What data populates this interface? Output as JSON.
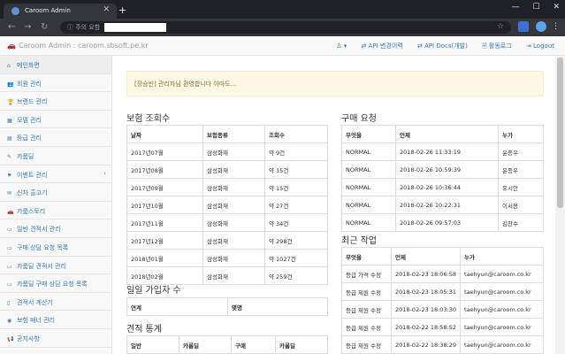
{
  "browser": {
    "tab_title": "Caroom Admin",
    "tab_close": "✕",
    "new_tab": "+",
    "window_controls": [
      "—",
      "☐",
      "✕"
    ],
    "security_label": "ⓘ 주의 요함",
    "back": "←",
    "forward": "→",
    "reload": "↻",
    "bookmark_star": "☆",
    "menu": "⋮"
  },
  "navbar": {
    "brand": "Caroom Admin : caroom.sbsoft.pe.kr",
    "brand_icon": "🚗",
    "user_menu": "♙ ▾",
    "api_changes": "⇄ API 변경이력",
    "api_docs": "⇄ API Docs(개발)",
    "activity_log": "🗎 활동로그",
    "logout": "⇥ Logout"
  },
  "sidebar": {
    "items": [
      {
        "icon": "⌂",
        "label": "메인화면"
      },
      {
        "icon": "👥",
        "label": "회원 관리"
      },
      {
        "icon": "🏆",
        "label": "브랜드 관리"
      },
      {
        "icon": "▦",
        "label": "모델 관리"
      },
      {
        "icon": "▤",
        "label": "등급 관리"
      },
      {
        "icon": "✎",
        "label": "카룸딜"
      },
      {
        "icon": "⚑",
        "label": "이벤트 관리"
      },
      {
        "icon": "✉",
        "label": "신차 출고기"
      },
      {
        "icon": "🚗",
        "label": "카룸스토리"
      },
      {
        "icon": "▭",
        "label": "일반 견적서 관리"
      },
      {
        "icon": "▭",
        "label": "구매 상담 요청 목록"
      },
      {
        "icon": "▭",
        "label": "카룸딜 견적서 관리"
      },
      {
        "icon": "▭",
        "label": "카룸딜 구매 상담 요청 목록"
      },
      {
        "icon": "▯",
        "label": "견적서 계산기"
      },
      {
        "icon": "◉",
        "label": "보험 배너 관리"
      },
      {
        "icon": "📢",
        "label": "공지사항"
      }
    ],
    "event_chevron": "‹"
  },
  "main": {
    "alert": "[장승빈] 관리자님 환영합니다 아마도...",
    "insurance": {
      "title": "보험 조회수",
      "headers": [
        "날짜",
        "보험종류",
        "조회수"
      ],
      "rows": [
        [
          "2017년07월",
          "삼성화재",
          "약 9건"
        ],
        [
          "2017년08월",
          "삼성화재",
          "약 15건"
        ],
        [
          "2017년09월",
          "삼성화재",
          "약 15건"
        ],
        [
          "2017년10월",
          "삼성화재",
          "약 27건"
        ],
        [
          "2017년11월",
          "삼성화재",
          "약 34건"
        ],
        [
          "2017년12월",
          "삼성화재",
          "약 298건"
        ],
        [
          "2018년01월",
          "삼성화재",
          "약 1027건"
        ],
        [
          "2018년02월",
          "삼성화재",
          "약 259건"
        ]
      ]
    },
    "signup": {
      "title": "일일 가입자 수",
      "headers": [
        "연계",
        "몇명"
      ]
    },
    "estimate": {
      "title": "견적 통계",
      "headers": [
        "일반",
        "카룸딜",
        "구매",
        "카룸딜"
      ]
    },
    "purchase": {
      "title": "구매 요청",
      "headers": [
        "무엇을",
        "언제",
        "누가"
      ],
      "rows": [
        [
          "NORMAL",
          "2018-02-26 11:33:19",
          "윤종우"
        ],
        [
          "NORMAL",
          "2018-02-26 10:59:39",
          "윤종우"
        ],
        [
          "NORMAL",
          "2018-02-26 10:36:44",
          "유시안"
        ],
        [
          "NORMAL",
          "2018-02-26 10:22:31",
          "이서용"
        ],
        [
          "NORMAL",
          "2018-02-26 09:57:03",
          "김찬수"
        ]
      ]
    },
    "recent": {
      "title": "최근 작업",
      "headers": [
        "무엇을",
        "언제",
        "누가"
      ],
      "rows": [
        [
          "등급 가격 수정",
          "2018-02-23 18:06:58",
          "taehyun@caroom.co.kr"
        ],
        [
          "등급 제원 수정",
          "2018-02-23 18:05:31",
          "taehyun@caroom.co.kr"
        ],
        [
          "등급 제원 수정",
          "2018-02-23 18:03:30",
          "taehyun@caroom.co.kr"
        ],
        [
          "등급 제원 수정",
          "2018-02-22 18:58:52",
          "taehyun@caroom.co.kr"
        ],
        [
          "등급 제원 수정",
          "2018-02-22 18:38:29",
          "taehyun@caroom.co.kr"
        ]
      ]
    }
  },
  "colors": {
    "link": "#337ab7",
    "alert_bg": "#fcf8e3",
    "alert_text": "#8a6d3b",
    "chrome_dark": "#202124"
  }
}
